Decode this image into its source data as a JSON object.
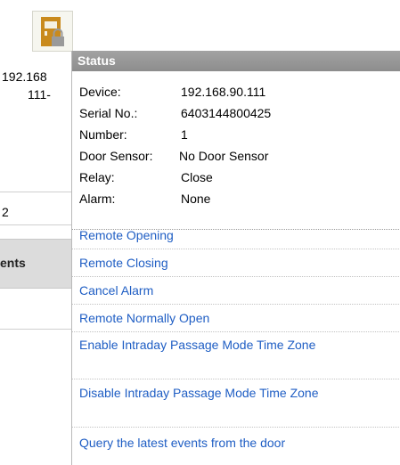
{
  "background": {
    "device_ip_partial": "192.168",
    "device_name_partial": "111-",
    "count_partial": "2",
    "events_tab_partial": "ents"
  },
  "popup": {
    "header": "Status",
    "fields": [
      {
        "label": "Device:",
        "value": "192.168.90.111"
      },
      {
        "label": "Serial No.:",
        "value": "6403144800425"
      },
      {
        "label": "Number:",
        "value": "1"
      },
      {
        "label": "Door Sensor:",
        "value": "No Door Sensor"
      },
      {
        "label": "Relay:",
        "value": "Close"
      },
      {
        "label": "Alarm:",
        "value": "None"
      }
    ],
    "actions": [
      "Remote Opening",
      "Remote Closing",
      "Cancel Alarm",
      "Remote Normally Open",
      "Enable Intraday Passage Mode Time Zone",
      "Disable Intraday Passage Mode Time Zone",
      "Query the latest events from the door"
    ]
  },
  "colors": {
    "header_gray": "#9a9a9a",
    "link_blue": "#1f5ec4",
    "door_icon": "#c98a1d"
  },
  "icons": {
    "door": "door-lock-icon"
  }
}
